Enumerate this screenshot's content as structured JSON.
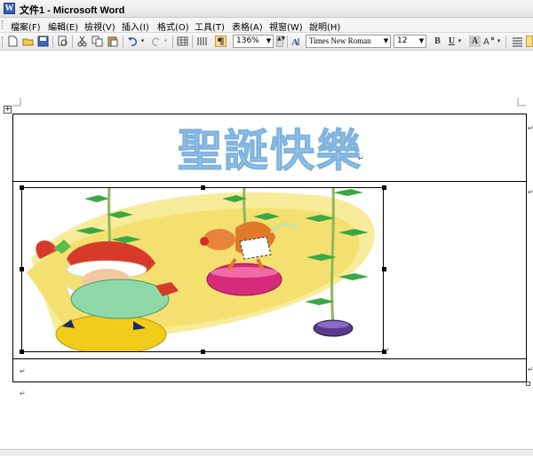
{
  "window": {
    "title": "文件1 - Microsoft Word",
    "icon_text": "W"
  },
  "menu": {
    "items": [
      "檔案(F)",
      "編輯(E)",
      "檢視(V)",
      "插入(I)",
      "格式(O)",
      "工具(T)",
      "表格(A)",
      "視窗(W)",
      "說明(H)"
    ]
  },
  "toolbar": {
    "zoom": "136%",
    "font_name": "Times New Roman",
    "font_size": "12",
    "bold": "B",
    "underline": "U",
    "char_style": "A"
  },
  "document": {
    "heading_text": "聖誕快樂",
    "heading_color": "#9cc8ec",
    "paragraph_mark": "↵"
  }
}
